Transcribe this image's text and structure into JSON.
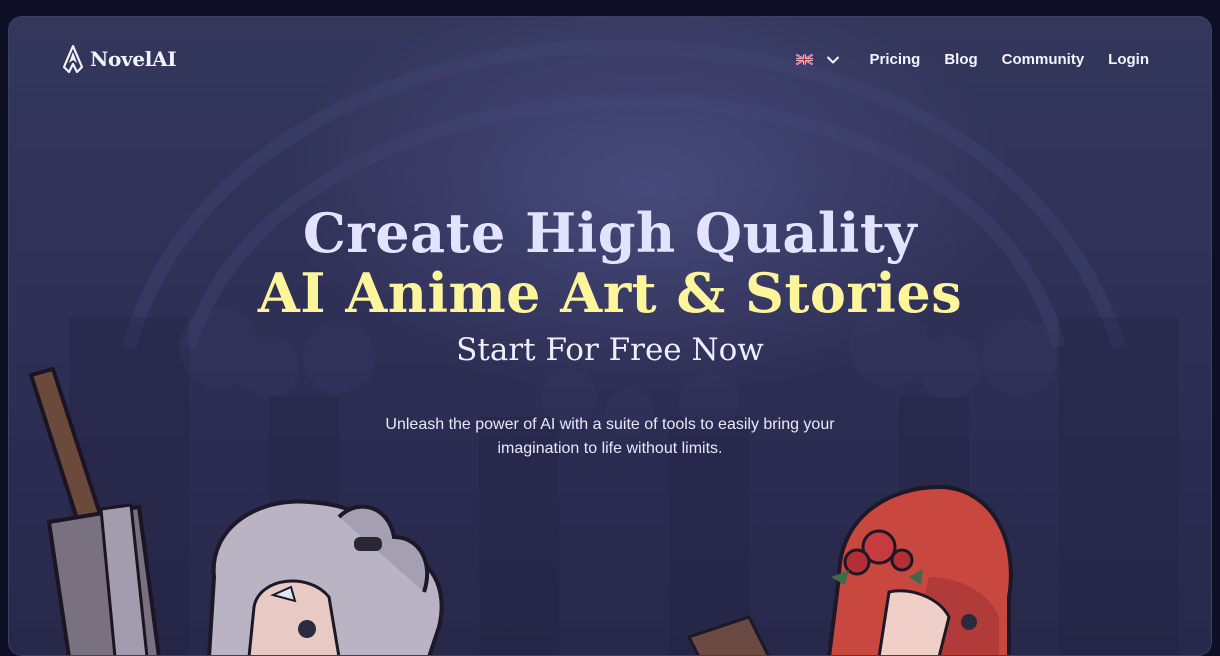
{
  "brand": {
    "name": "NovelAI",
    "icon": "novelai-logo-icon"
  },
  "nav": {
    "language": {
      "flag": "uk-flag-icon",
      "chevron": "chevron-down-icon"
    },
    "links": [
      {
        "label": "Pricing"
      },
      {
        "label": "Blog"
      },
      {
        "label": "Community"
      },
      {
        "label": "Login"
      }
    ]
  },
  "hero": {
    "line1": "Create High Quality",
    "line2": "AI Anime Art & Stories",
    "line3": "Start For Free Now",
    "description": "Unleash the power of AI with a suite of tools to easily bring your imagination to life without limits."
  },
  "colors": {
    "background": "#2f3157",
    "page": "#0e0f24",
    "heading": "#e2e4ff",
    "accent": "#fdf59b",
    "text": "#f4f3ff"
  }
}
